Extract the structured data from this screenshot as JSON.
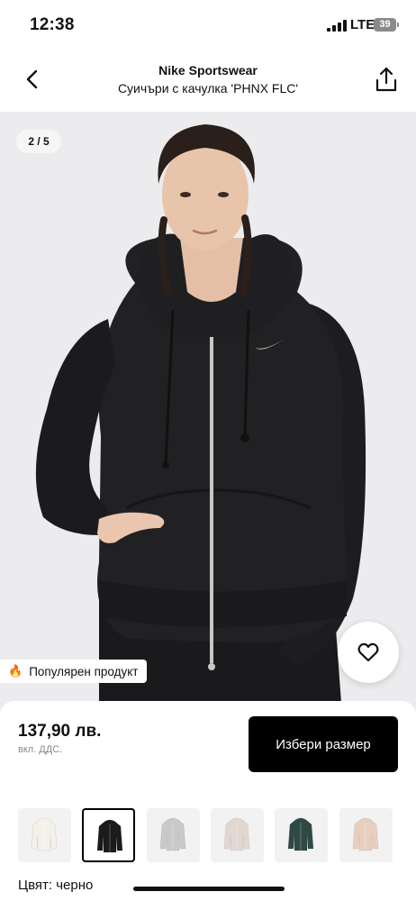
{
  "status_bar": {
    "time": "12:38",
    "network": "LTE",
    "battery": "39"
  },
  "header": {
    "brand": "Nike Sportswear",
    "product_name": "Суичъри с качулка 'PHNX FLC'",
    "back_icon": "chevron-left-icon",
    "share_icon": "share-icon"
  },
  "gallery": {
    "counter": "2 / 5",
    "popular_badge_icon": "🔥",
    "popular_badge_text": "Популярен продукт",
    "favorite_icon": "heart-icon"
  },
  "purchase": {
    "price": "137,90 лв.",
    "vat_note": "вкл. ДДС.",
    "select_size_label": "Избери размер"
  },
  "colors": {
    "swatches": [
      {
        "name": "white",
        "color": "#f4f1ea",
        "selected": false
      },
      {
        "name": "black",
        "color": "#1b1b1d",
        "selected": true
      },
      {
        "name": "grey",
        "color": "#c9c9c9",
        "selected": false
      },
      {
        "name": "light-pink",
        "color": "#e3d7d2",
        "selected": false
      },
      {
        "name": "dark-green",
        "color": "#2f4a44",
        "selected": false
      },
      {
        "name": "beige-pink",
        "color": "#e8cfbd",
        "selected": false
      }
    ],
    "label": "Цвят: черно"
  }
}
